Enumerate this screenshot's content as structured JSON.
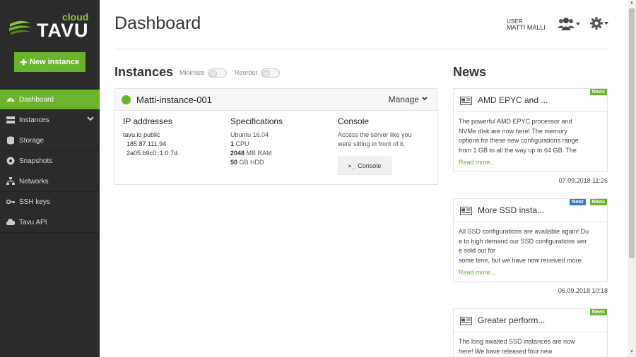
{
  "brand": {
    "cloud": "cloud",
    "name": "TAVU"
  },
  "sidebar": {
    "new_instance": "New instance",
    "items": [
      {
        "label": "Dashboard",
        "icon": "dashboard-icon",
        "active": true
      },
      {
        "label": "Instances",
        "icon": "server-icon",
        "active": false
      },
      {
        "label": "Storage",
        "icon": "database-icon",
        "active": false
      },
      {
        "label": "Snapshots",
        "icon": "snapshot-icon",
        "active": false
      },
      {
        "label": "Networks",
        "icon": "network-icon",
        "active": false
      },
      {
        "label": "SSH keys",
        "icon": "key-icon",
        "active": false
      },
      {
        "label": "Tavu API",
        "icon": "cloud-icon",
        "active": false
      }
    ]
  },
  "header": {
    "title": "Dashboard",
    "user_caption": "USER",
    "user_name": "MATTI MALLI"
  },
  "instances": {
    "title": "Instances",
    "minimize_label": "Minimize",
    "reorder_label": "Reorder",
    "card": {
      "name": "Matti-instance-001",
      "manage": "Manage",
      "ip_title": "IP addresses",
      "ip_label": "tavu.io public",
      "ipv4": "185.87.111.94",
      "ipv6": "2a05:b9c0::1:0:7d",
      "spec_title": "Specifications",
      "os": "Ubuntu 16.04",
      "cpu_value": "1",
      "cpu_unit": "CPU",
      "ram_value": "2048",
      "ram_unit": "MB RAM",
      "hdd_value": "50",
      "hdd_unit": "GB HDD",
      "console_title": "Console",
      "console_desc_1": "Access the server like you",
      "console_desc_2": "were sitting in front of it.",
      "console_button": "Console"
    }
  },
  "news": {
    "title": "News",
    "items": [
      {
        "title": "AMD EPYC and ...",
        "lines": [
          "The powerful AMD EPYC processor and",
          "NVMe disk are now here! The memory",
          "options for these new configurations range",
          "from 1 GB to all the way up to 64 GB.  The"
        ],
        "read_more": "Read more...",
        "date": "07.09.2018 11:26",
        "badge_news": "News",
        "badge_new": ""
      },
      {
        "title": "More SSD insta...",
        "lines": [
          "All SSD configurations are available again! Du",
          "e to high demand our SSD configurations wer",
          "e sold out for",
          "some time, but we have now received more"
        ],
        "read_more": "Read more...",
        "date": "06.09.2018 10:18",
        "badge_news": "News",
        "badge_new": "New!"
      },
      {
        "title": "Greater perform...",
        "lines": [
          "The long awaited SSD instances are now",
          "here! We have released four new"
        ],
        "read_more": "",
        "date": "",
        "badge_news": "News",
        "badge_new": ""
      }
    ]
  },
  "colors": {
    "accent": "#6ab42d",
    "sidebar_bg": "#2b2b2b",
    "new_badge": "#2d7bc6"
  }
}
